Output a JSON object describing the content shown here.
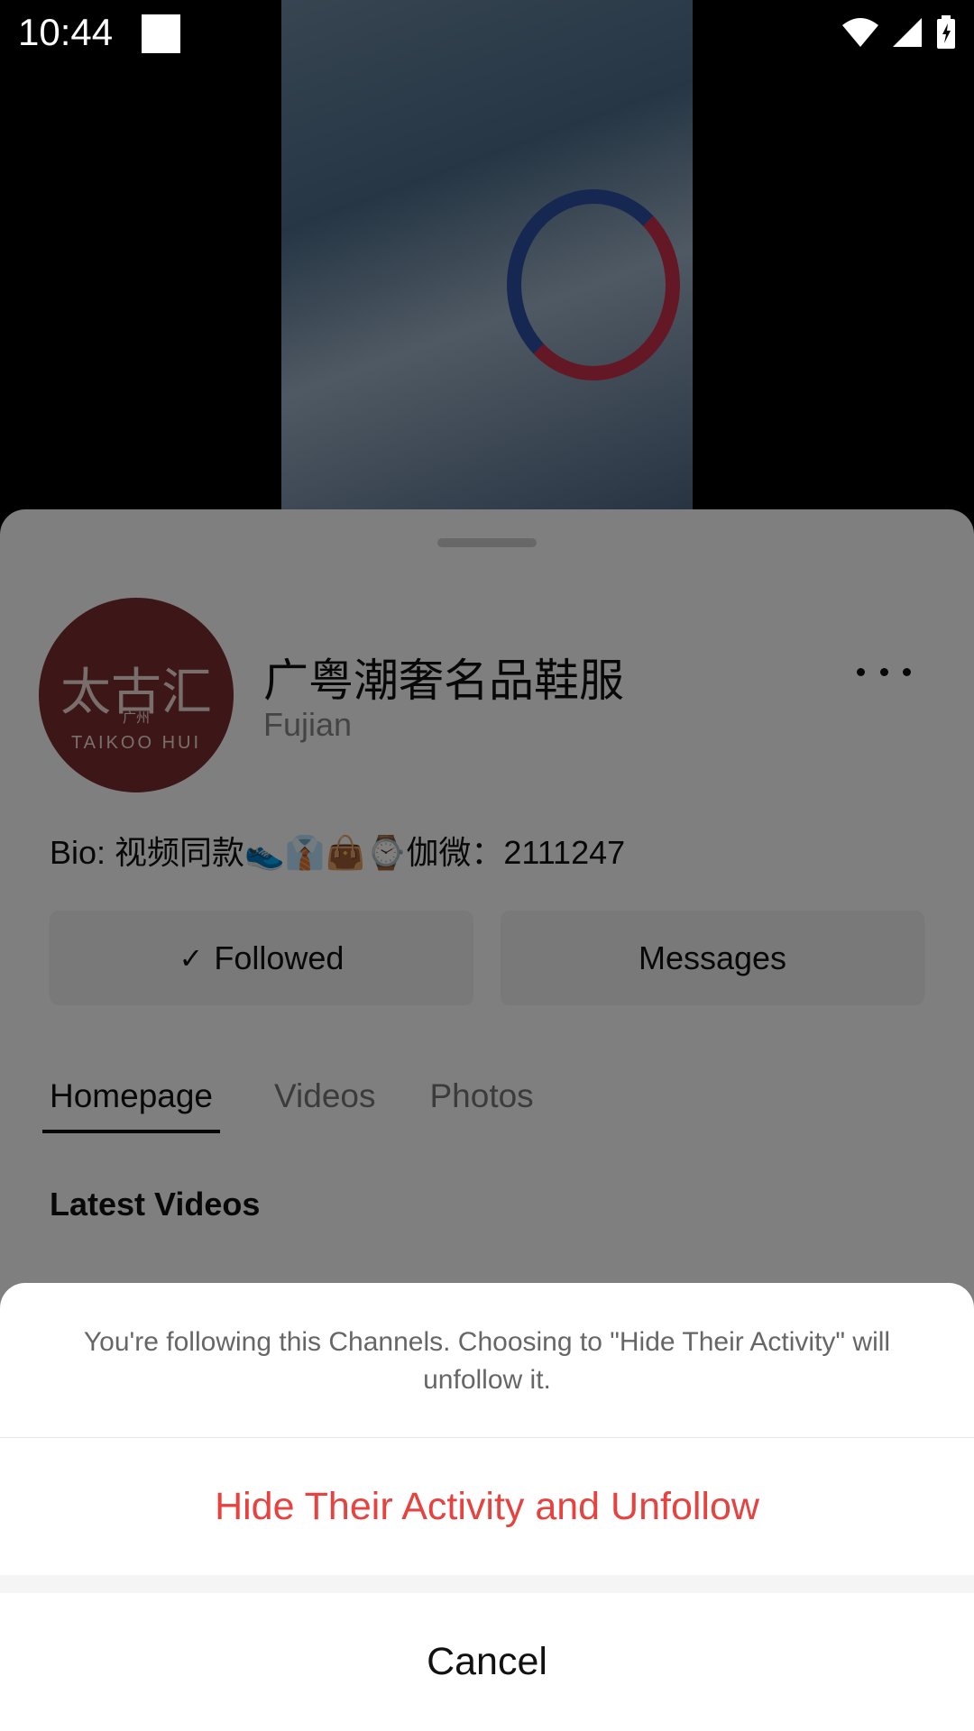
{
  "status_bar": {
    "time": "10:44"
  },
  "video": {
    "description_icon": "video-thumbnail"
  },
  "profile": {
    "avatar": {
      "text_cn": "太古汇",
      "text_sub": "广州",
      "text_en": "TAIKOO HUI"
    },
    "name": "广粤潮奢名品鞋服",
    "location": "Fujian",
    "bio": "Bio: 视频同款👟👔👜⌚伽微：2111247",
    "buttons": {
      "followed": "Followed",
      "messages": "Messages"
    },
    "tabs": [
      "Homepage",
      "Videos",
      "Photos"
    ],
    "section_title": "Latest Videos"
  },
  "action_sheet": {
    "description": "You're following this Channels. Choosing to \"Hide Their Activity\" will unfollow it.",
    "primary": "Hide Their Activity and Unfollow",
    "cancel": "Cancel"
  },
  "colors": {
    "destructive": "#e64340",
    "overlay": "rgba(0,0,0,0.5)"
  }
}
